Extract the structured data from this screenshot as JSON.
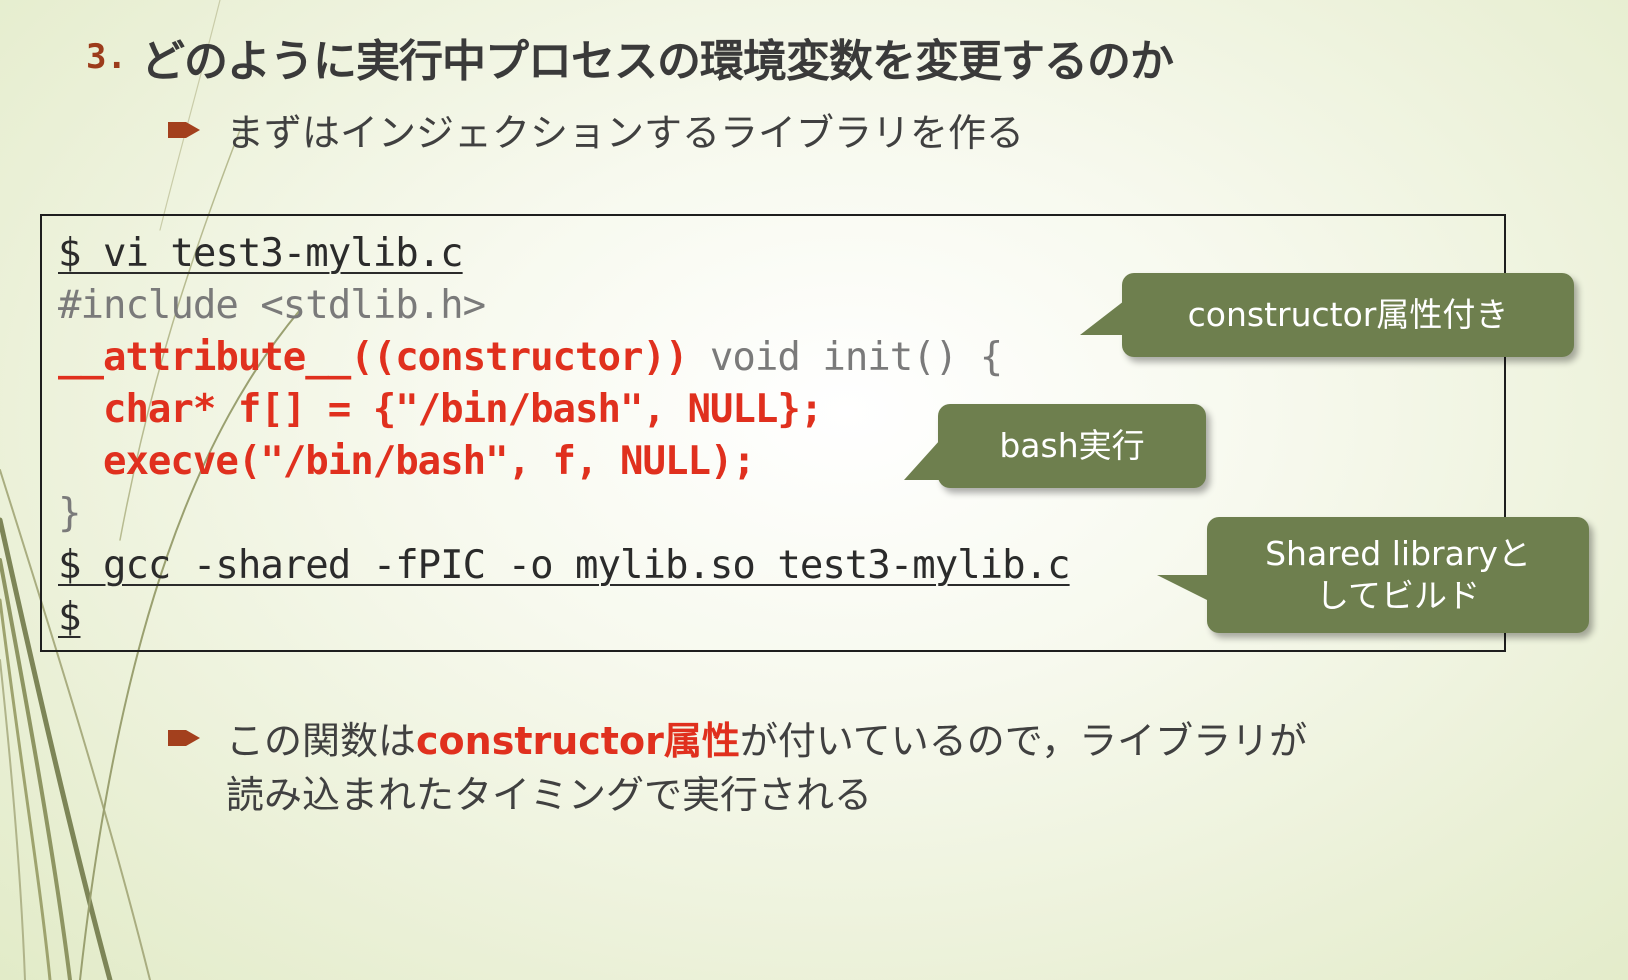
{
  "title": {
    "number": "3.",
    "text": "どのように実行中プロセスの環境変数を変更するのか"
  },
  "bullets": [
    {
      "text": "まずはインジェクションするライブラリを作る"
    },
    {
      "before": "この関数は",
      "highlight": "constructor属性",
      "after": "が付いているので，ライブラリが",
      "line2": "読み込まれたタイミングで実行される"
    }
  ],
  "code": {
    "line1": "$ vi test3-mylib.c",
    "line2": "#include <stdlib.h>",
    "line3_red": "__attribute__((constructor))",
    "line3_gray": " void init() {",
    "line4": "  char* f[] = {\"/bin/bash\", NULL};",
    "line5": "  execve(\"/bin/bash\", f, NULL);",
    "line6": "}",
    "line7": "$ gcc -shared -fPIC -o mylib.so test3-mylib.c",
    "line8": "$"
  },
  "callouts": {
    "constructor": "constructor属性付き",
    "bash": "bash実行",
    "shared_line1": "Shared libraryと",
    "shared_line2": "してビルド"
  },
  "colors": {
    "accent_red": "#e0301e",
    "title_number": "#9c3b1b",
    "callout_bg": "#6e7f4e",
    "bullet": "#a3401d"
  },
  "icons": {
    "bullet": "arrow-bullet-icon"
  }
}
